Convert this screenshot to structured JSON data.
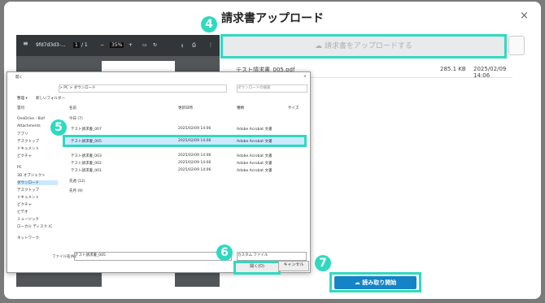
{
  "modal": {
    "title": "請求書アップロード",
    "close_label": "×"
  },
  "pdf_viewer": {
    "filename": "9fd7d3d3-...",
    "page_current": "1",
    "page_total": "/ 1",
    "zoom": "35%"
  },
  "upload": {
    "drop_label": "請求書をアップロードする",
    "step_number": "4"
  },
  "file_entry": {
    "name": "テスト請求書_005.pdf",
    "size": "285.1 KB",
    "date": "2025/02/09 14:06"
  },
  "dialog": {
    "title": "開く",
    "path": "> PC > ダウンロード",
    "search_placeholder": "ダウンロードの検索",
    "organize_label": "整理 ▾",
    "new_folder_label": "新しいフォルダー",
    "columns": [
      "名前",
      "更新日時",
      "種類",
      "サイズ"
    ],
    "group_today": "今日 (7)",
    "group_last_week": "先週 (12)",
    "group_last_month": "先月 (9)",
    "files": [
      {
        "name": "テスト請求書_007",
        "date": "2025/02/09 14:06",
        "type": "Adobe Acrobat 文書"
      },
      {
        "name": "テスト請求書_005",
        "date": "2025/02/09 14:06",
        "type": "Adobe Acrobat 文書"
      },
      {
        "name": "テスト請求書_003",
        "date": "2025/02/09 14:06",
        "type": "Adobe Acrobat 文書"
      },
      {
        "name": "テスト請求書_002",
        "date": "2025/02/09 14:06",
        "type": "Adobe Acrobat 文書"
      },
      {
        "name": "テスト請求書_001",
        "date": "2025/02/09 14:06",
        "type": "Adobe Acrobat 文書"
      }
    ],
    "nav_items": [
      "雲司",
      "OneDrive - Bizf",
      "Attachments",
      "アプリ",
      "デスクトップ",
      "ドキュメント",
      "ピクチャ",
      "PC",
      "3D オブジェクト",
      "ダウンロード",
      "デスクトップ",
      "ドキュメント",
      "ピクチャ",
      "ビデオ",
      "ミュージック",
      "ローカル ディスク (C",
      "ネットワーク"
    ],
    "filename_label": "ファイル名(N):",
    "filename_value": "テスト請求書_005",
    "filetype_value": "カスタム ファイル",
    "open_label": "開く(O)",
    "cancel_label": "キャンセル"
  },
  "steps": {
    "five": "5",
    "six": "6",
    "seven": "7"
  },
  "start_button": {
    "label": "読み取り開始"
  }
}
